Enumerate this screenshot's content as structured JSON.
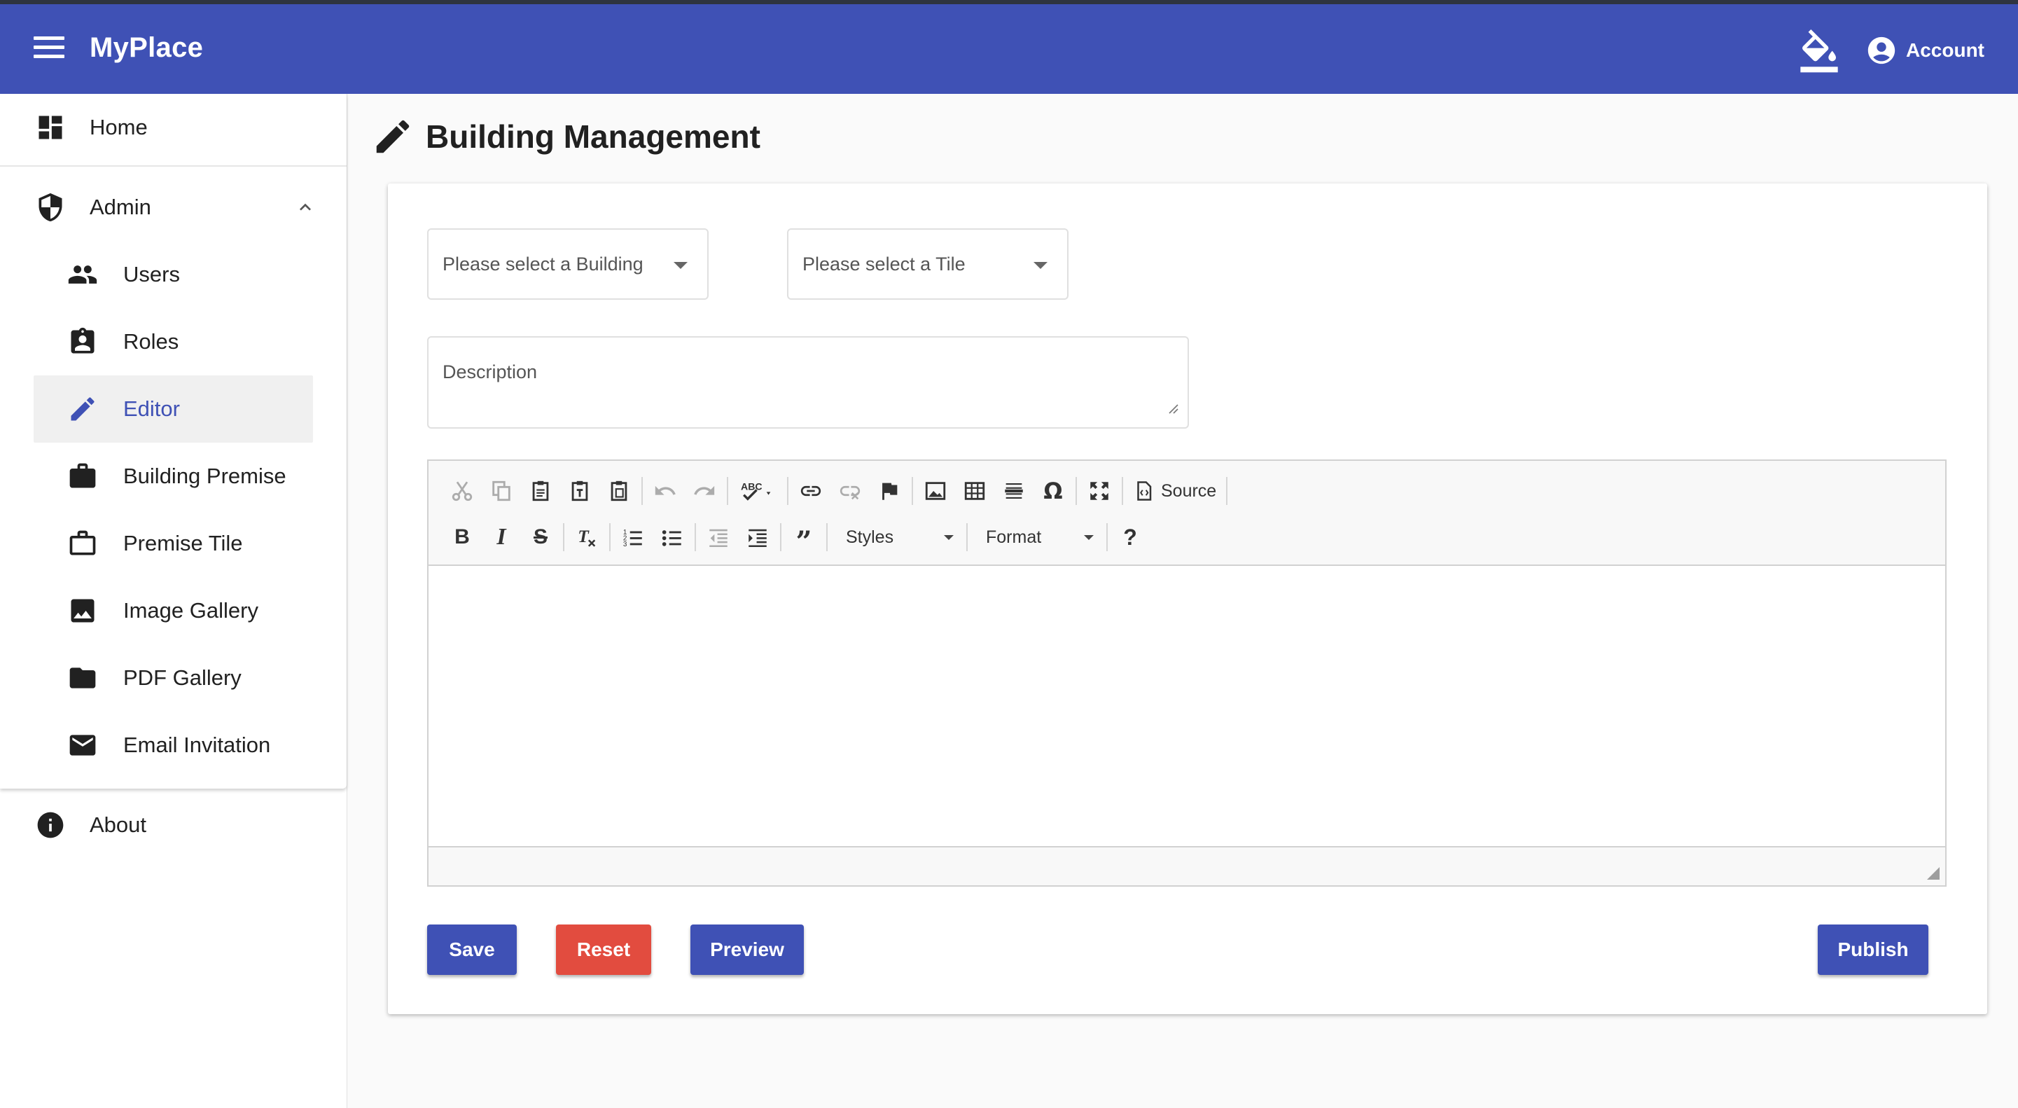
{
  "app": {
    "title": "MyPlace"
  },
  "header": {
    "account_label": "Account"
  },
  "sidebar": {
    "home": "Home",
    "admin": "Admin",
    "admin_items": [
      {
        "label": "Users",
        "icon": "people-icon"
      },
      {
        "label": "Roles",
        "icon": "assignment-ind-icon"
      },
      {
        "label": "Editor",
        "icon": "pencil-icon",
        "active": true
      },
      {
        "label": "Building Premise",
        "icon": "briefcase-icon"
      },
      {
        "label": "Premise Tile",
        "icon": "briefcase-outline-icon"
      },
      {
        "label": "Image Gallery",
        "icon": "image-icon"
      },
      {
        "label": "PDF Gallery",
        "icon": "folder-icon"
      },
      {
        "label": "Email Invitation",
        "icon": "mail-icon"
      }
    ],
    "about": "About"
  },
  "page": {
    "title": "Building Management"
  },
  "form": {
    "building_select": "Please select a Building",
    "tile_select": "Please select a Tile",
    "description_placeholder": "Description"
  },
  "editor": {
    "source_label": "Source",
    "styles_label": "Styles",
    "format_label": "Format",
    "help_label": "?"
  },
  "actions": {
    "save": "Save",
    "reset": "Reset",
    "preview": "Preview",
    "publish": "Publish"
  },
  "colors": {
    "primary": "#3f51b5",
    "danger": "#e24c3f"
  }
}
